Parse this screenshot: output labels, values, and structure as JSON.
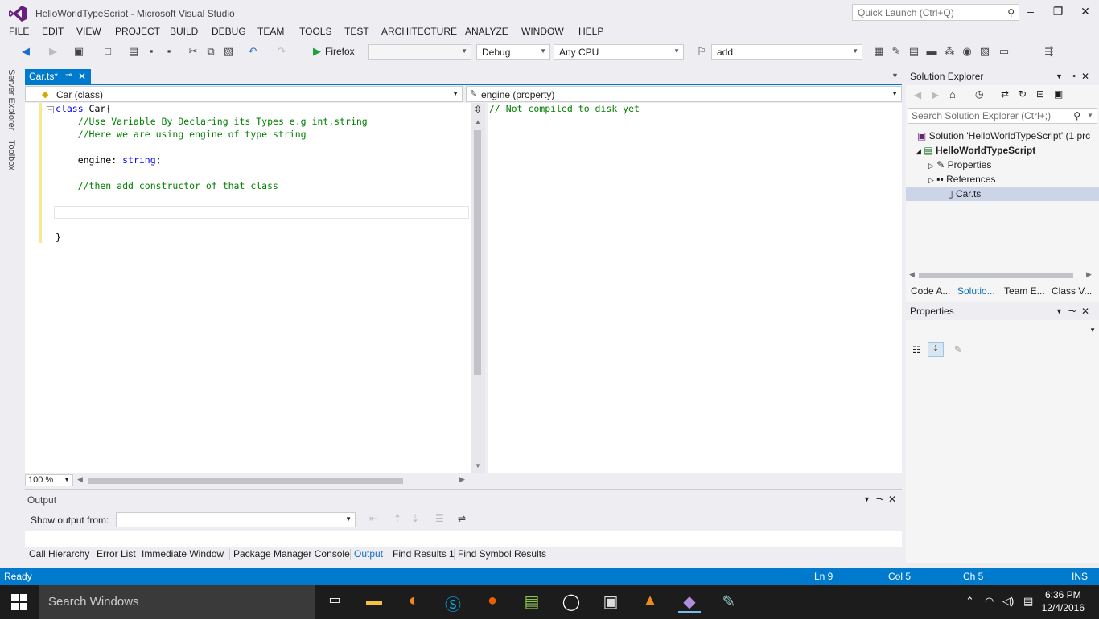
{
  "window": {
    "title": "HelloWorldTypeScript - Microsoft Visual Studio",
    "quick_launch_placeholder": "Quick Launch (Ctrl+Q)"
  },
  "menu": [
    "FILE",
    "EDIT",
    "VIEW",
    "PROJECT",
    "BUILD",
    "DEBUG",
    "TEAM",
    "TOOLS",
    "TEST",
    "ARCHITECTURE",
    "ANALYZE",
    "WINDOW",
    "HELP"
  ],
  "toolbar": {
    "run_target": "Firefox",
    "config": "Debug",
    "platform": "Any CPU",
    "find_text": "add"
  },
  "left_rail": {
    "server_explorer": "Server Explorer",
    "toolbox": "Toolbox"
  },
  "document_tab": {
    "label": "Car.ts*"
  },
  "navbar": {
    "type_combo": "Car (class)",
    "member_combo": "engine (property)"
  },
  "code_lines": [
    {
      "kind": "decl",
      "kw": "class",
      "rest": " Car{"
    },
    {
      "kind": "comment",
      "text": "    //Use Variable By Declaring its Types e.g int,string"
    },
    {
      "kind": "comment",
      "text": "    //Here we are using engine of type string"
    },
    {
      "kind": "blank",
      "text": ""
    },
    {
      "kind": "field",
      "pre": "    engine: ",
      "kw": "string",
      "post": ";"
    },
    {
      "kind": "blank",
      "text": ""
    },
    {
      "kind": "comment",
      "text": "    //then add constructor of that class"
    },
    {
      "kind": "blank",
      "text": ""
    },
    {
      "kind": "blank",
      "text": ""
    },
    {
      "kind": "blank",
      "text": ""
    },
    {
      "kind": "close",
      "text": "}"
    }
  ],
  "preview": {
    "text": "// Not compiled to disk yet"
  },
  "zoom": "100 %",
  "output": {
    "title": "Output",
    "show_from_label": "Show output from:"
  },
  "bottom_tabs": [
    "Call Hierarchy",
    "Error List",
    "Immediate Window",
    "Package Manager Console",
    "Output",
    "Find Results 1",
    "Find Symbol Results"
  ],
  "solution_explorer": {
    "title": "Solution Explorer",
    "search_placeholder": "Search Solution Explorer (Ctrl+;)",
    "items": [
      {
        "label": "Solution 'HelloWorldTypeScript' (1 prc"
      },
      {
        "label": "HelloWorldTypeScript"
      },
      {
        "label": "Properties"
      },
      {
        "label": "References"
      },
      {
        "label": "Car.ts"
      }
    ],
    "tabs": [
      "Code A...",
      "Solutio...",
      "Team E...",
      "Class V..."
    ]
  },
  "properties": {
    "title": "Properties"
  },
  "status": {
    "state": "Ready",
    "ln": "Ln 9",
    "col": "Col 5",
    "ch": "Ch 5",
    "mode": "INS"
  },
  "taskbar": {
    "search": "Search Windows",
    "time": "6:36 PM",
    "date": "12/4/2016"
  }
}
